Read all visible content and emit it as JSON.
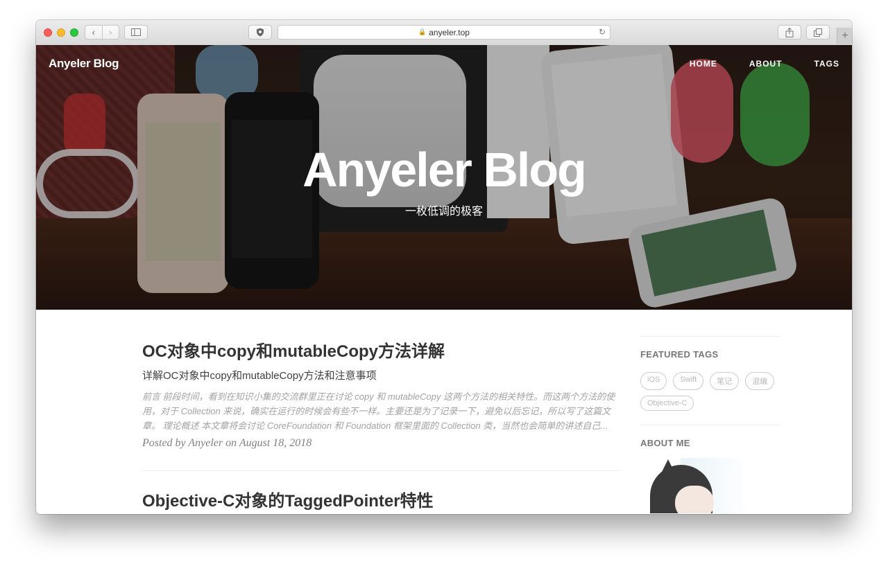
{
  "browser": {
    "url": "anyeler.top"
  },
  "site": {
    "brand": "Anyeler Blog",
    "nav": [
      "HOME",
      "ABOUT",
      "TAGS"
    ],
    "hero_title": "Anyeler Blog",
    "hero_subtitle": "一枚低调的极客"
  },
  "posts": [
    {
      "title": "OC对象中copy和mutableCopy方法详解",
      "subtitle": "详解OC对象中copy和mutableCopy方法和注意事项",
      "excerpt": "前言 前段时间，看到在知识小集的交流群里正在讨论 copy 和 mutableCopy 这两个方法的相关特性。而这两个方法的使用，对于 Collection 来说，确实在运行的时候会有些不一样。主要还是为了记录一下，避免以后忘记，所以写了这篇文章。 理论概述 本文章将会讨论 CoreFoundation 和 Foundation 框架里面的 Collection 类，当然也会简单的讲述自己...",
      "meta": "Posted by Anyeler on August 18, 2018"
    },
    {
      "title": "Objective-C对象的TaggedPointer特性"
    }
  ],
  "sidebar": {
    "featured_tags_heading": "FEATURED TAGS",
    "tags": [
      "iOS",
      "Swift",
      "笔记",
      "混编",
      "Objective-C"
    ],
    "about_heading": "ABOUT ME"
  },
  "colors": {
    "accent": "#333333",
    "tag_border": "#cccccc"
  }
}
